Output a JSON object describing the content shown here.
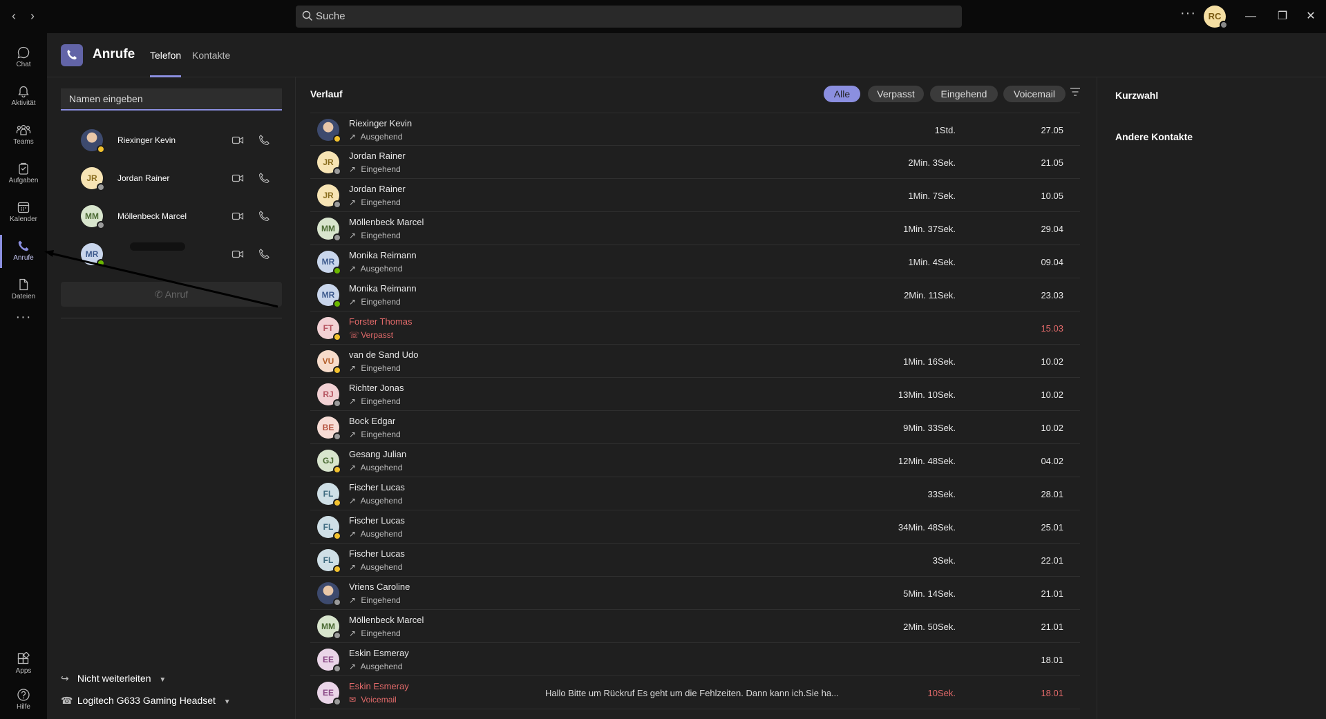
{
  "titlebar": {
    "back_icon": "chevron-left-icon",
    "forward_icon": "chevron-right-icon",
    "search_placeholder": "Suche",
    "more_label": "···",
    "user_initials": "RC",
    "minimize_label": "—",
    "restore_label": "❐",
    "close_label": "✕"
  },
  "rail": {
    "items": [
      {
        "label": "Chat",
        "icon": "chat-icon"
      },
      {
        "label": "Aktivität",
        "icon": "bell-icon"
      },
      {
        "label": "Teams",
        "icon": "teams-icon"
      },
      {
        "label": "Aufgaben",
        "icon": "tasks-icon"
      },
      {
        "label": "Kalender",
        "icon": "calendar-icon"
      },
      {
        "label": "Anrufe",
        "icon": "phone-icon"
      },
      {
        "label": "Dateien",
        "icon": "file-icon"
      }
    ],
    "more_label": "···",
    "apps_label": "Apps",
    "help_label": "Hilfe",
    "active_color": "#8b8fe0"
  },
  "header": {
    "title": "Anrufe",
    "tabs": [
      {
        "label": "Telefon",
        "active": true
      },
      {
        "label": "Kontakte",
        "active": false
      }
    ]
  },
  "dial": {
    "input_placeholder": "Namen eingeben",
    "speed_dial": [
      {
        "name": "Riexinger Kevin",
        "initials": "",
        "photo": true,
        "status": "away",
        "bg": "#3d4a6e",
        "fg": "#fff"
      },
      {
        "name": "Jordan Rainer",
        "initials": "JR",
        "photo": false,
        "status": "off",
        "bg": "#f7e4b4",
        "fg": "#8a6d1e"
      },
      {
        "name": "Möllenbeck Marcel",
        "initials": "MM",
        "photo": false,
        "status": "off",
        "bg": "#d8e5cd",
        "fg": "#4b6b34"
      },
      {
        "name": "",
        "initials": "MR",
        "photo": false,
        "status": "on",
        "bg": "#c9d6ec",
        "fg": "#3e5b8e"
      }
    ],
    "call_button": "Anruf",
    "forward_label": "Nicht weiterleiten",
    "device_label": "Logitech G633 Gaming Headset"
  },
  "history": {
    "title": "Verlauf",
    "filters": [
      "Alle",
      "Verpasst",
      "Eingehend",
      "Voicemail"
    ],
    "active_filter": "Alle",
    "rows": [
      {
        "name": "Riexinger Kevin",
        "initials": "",
        "photo": true,
        "status": "away",
        "bg": "#3d4a6e",
        "fg": "#fff",
        "type": "Ausgehend",
        "duration": "1Std.",
        "date": "27.05",
        "preview": "",
        "missed": false
      },
      {
        "name": "Jordan Rainer",
        "initials": "JR",
        "photo": false,
        "status": "off",
        "bg": "#f7e4b4",
        "fg": "#8a6d1e",
        "type": "Eingehend",
        "duration": "2Min. 3Sek.",
        "date": "21.05",
        "preview": "",
        "missed": false
      },
      {
        "name": "Jordan Rainer",
        "initials": "JR",
        "photo": false,
        "status": "off",
        "bg": "#f7e4b4",
        "fg": "#8a6d1e",
        "type": "Eingehend",
        "duration": "1Min. 7Sek.",
        "date": "10.05",
        "preview": "",
        "missed": false
      },
      {
        "name": "Möllenbeck Marcel",
        "initials": "MM",
        "photo": false,
        "status": "off",
        "bg": "#d8e5cd",
        "fg": "#4b6b34",
        "type": "Eingehend",
        "duration": "1Min. 37Sek.",
        "date": "29.04",
        "preview": "",
        "missed": false
      },
      {
        "name": "Monika Reimann",
        "initials": "MR",
        "photo": false,
        "status": "on",
        "bg": "#c9d6ec",
        "fg": "#3e5b8e",
        "type": "Ausgehend",
        "duration": "1Min. 4Sek.",
        "date": "09.04",
        "preview": "",
        "missed": false
      },
      {
        "name": "Monika Reimann",
        "initials": "MR",
        "photo": false,
        "status": "on",
        "bg": "#c9d6ec",
        "fg": "#3e5b8e",
        "type": "Eingehend",
        "duration": "2Min. 11Sek.",
        "date": "23.03",
        "preview": "",
        "missed": false
      },
      {
        "name": "Forster Thomas",
        "initials": "FT",
        "photo": false,
        "status": "away",
        "bg": "#f2d1d4",
        "fg": "#b5535f",
        "type": "Verpasst",
        "duration": "",
        "date": "15.03",
        "preview": "",
        "missed": true
      },
      {
        "name": "van de Sand Udo",
        "initials": "VU",
        "photo": false,
        "status": "away",
        "bg": "#f7dccb",
        "fg": "#b45e2a",
        "type": "Eingehend",
        "duration": "1Min. 16Sek.",
        "date": "10.02",
        "preview": "",
        "missed": false
      },
      {
        "name": "Richter Jonas",
        "initials": "RJ",
        "photo": false,
        "status": "off",
        "bg": "#f2d1d4",
        "fg": "#b5535f",
        "type": "Eingehend",
        "duration": "13Min. 10Sek.",
        "date": "10.02",
        "preview": "",
        "missed": false
      },
      {
        "name": "Bock Edgar",
        "initials": "BE",
        "photo": false,
        "status": "off",
        "bg": "#f7dcd5",
        "fg": "#b5533f",
        "type": "Eingehend",
        "duration": "9Min. 33Sek.",
        "date": "10.02",
        "preview": "",
        "missed": false
      },
      {
        "name": "Gesang Julian",
        "initials": "GJ",
        "photo": false,
        "status": "away",
        "bg": "#d8e5cd",
        "fg": "#4b6b34",
        "type": "Ausgehend",
        "duration": "12Min. 48Sek.",
        "date": "04.02",
        "preview": "",
        "missed": false
      },
      {
        "name": "Fischer Lucas",
        "initials": "FL",
        "photo": false,
        "status": "away",
        "bg": "#cfdfe6",
        "fg": "#3f6b80",
        "type": "Ausgehend",
        "duration": "33Sek.",
        "date": "28.01",
        "preview": "",
        "missed": false
      },
      {
        "name": "Fischer Lucas",
        "initials": "FL",
        "photo": false,
        "status": "away",
        "bg": "#cfdfe6",
        "fg": "#3f6b80",
        "type": "Ausgehend",
        "duration": "34Min. 48Sek.",
        "date": "25.01",
        "preview": "",
        "missed": false
      },
      {
        "name": "Fischer Lucas",
        "initials": "FL",
        "photo": false,
        "status": "away",
        "bg": "#cfdfe6",
        "fg": "#3f6b80",
        "type": "Ausgehend",
        "duration": "3Sek.",
        "date": "22.01",
        "preview": "",
        "missed": false
      },
      {
        "name": "Vriens Caroline",
        "initials": "",
        "photo": true,
        "status": "off",
        "bg": "#8a6f5a",
        "fg": "#fff",
        "type": "Eingehend",
        "duration": "5Min. 14Sek.",
        "date": "21.01",
        "preview": "",
        "missed": false
      },
      {
        "name": "Möllenbeck Marcel",
        "initials": "MM",
        "photo": false,
        "status": "off",
        "bg": "#d8e5cd",
        "fg": "#4b6b34",
        "type": "Eingehend",
        "duration": "2Min. 50Sek.",
        "date": "21.01",
        "preview": "",
        "missed": false
      },
      {
        "name": "Eskin Esmeray",
        "initials": "EE",
        "photo": false,
        "status": "off",
        "bg": "#ead5e8",
        "fg": "#8a4a86",
        "type": "Ausgehend",
        "duration": "",
        "date": "18.01",
        "preview": "",
        "missed": false
      },
      {
        "name": "Eskin Esmeray",
        "initials": "EE",
        "photo": false,
        "status": "off",
        "bg": "#ead5e8",
        "fg": "#8a4a86",
        "type": "Voicemail",
        "duration": "10Sek.",
        "date": "18.01",
        "preview": "Hallo Bitte um Rückruf Es geht um die Fehlzeiten. Dann kann ich.Sie ha...",
        "missed": true
      }
    ]
  },
  "right": {
    "speed_dial_title": "Kurzwahl",
    "other_contacts_title": "Andere Kontakte"
  }
}
